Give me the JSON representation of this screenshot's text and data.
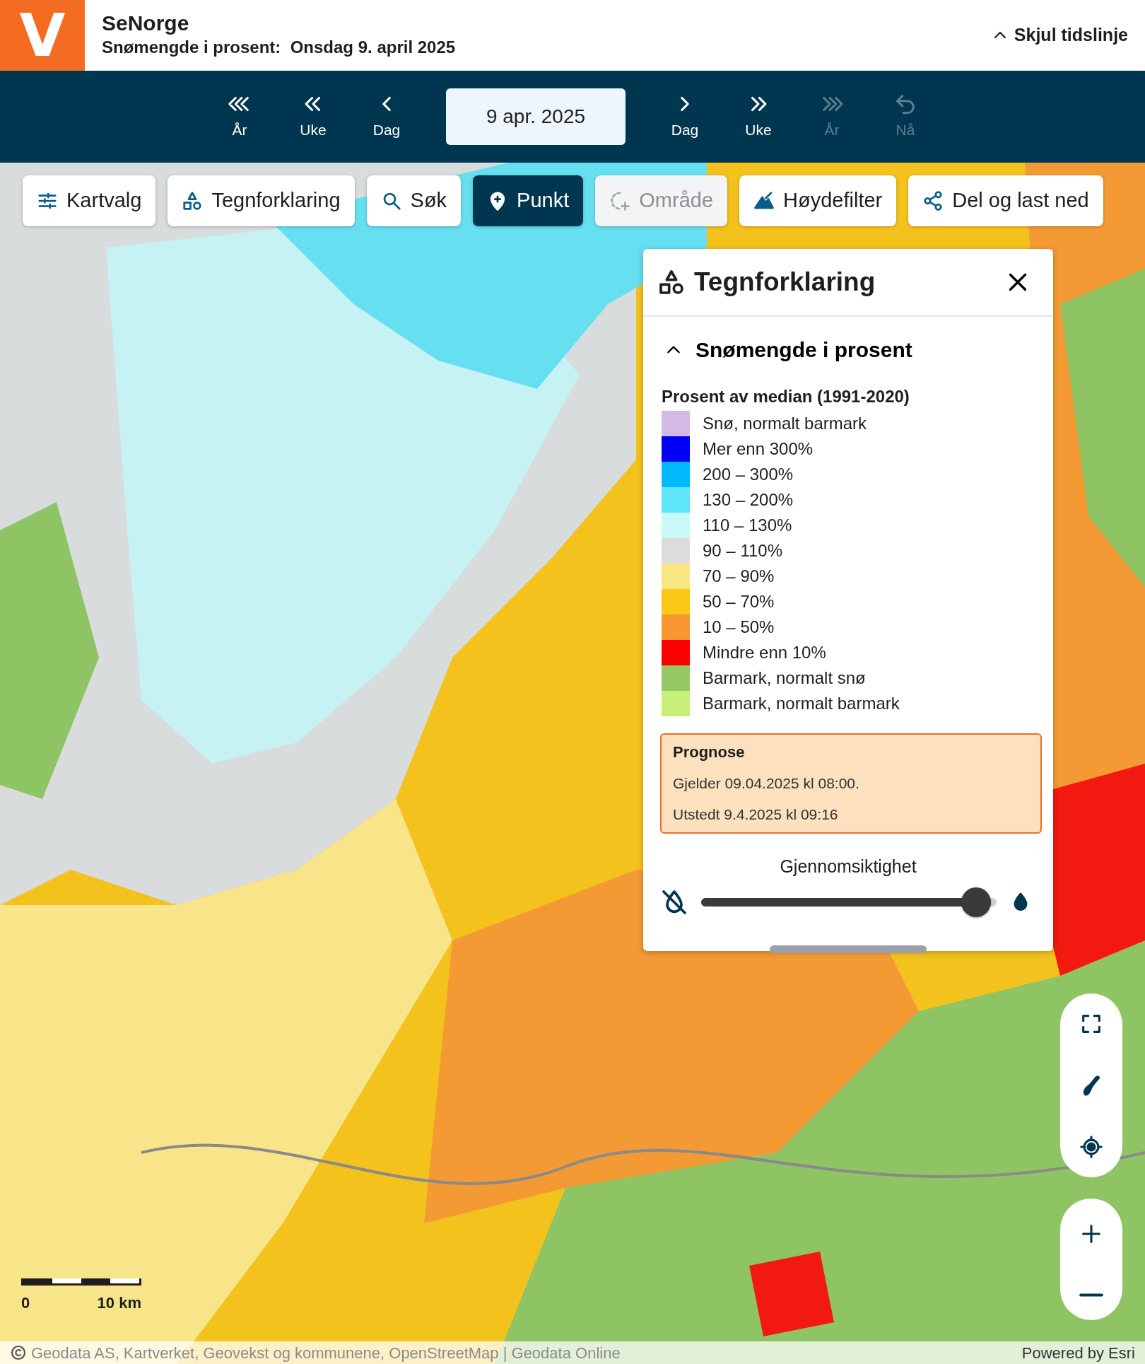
{
  "header": {
    "logo": "V",
    "title": "SeNorge",
    "subtitle": "Snømengde i prosent:  Onsdag 9. april 2025",
    "toggle": "Skjul tidslinje"
  },
  "timeline": {
    "back": [
      {
        "kind": "year-back",
        "label": "År",
        "disabled": false
      },
      {
        "kind": "week-back",
        "label": "Uke",
        "disabled": false
      },
      {
        "kind": "day-back",
        "label": "Dag",
        "disabled": false
      }
    ],
    "date": "9 apr. 2025",
    "forward": [
      {
        "kind": "day-forward",
        "label": "Dag",
        "disabled": false
      },
      {
        "kind": "week-forward",
        "label": "Uke",
        "disabled": false
      },
      {
        "kind": "year-forward",
        "label": "År",
        "disabled": true
      },
      {
        "kind": "now",
        "label": "Nå",
        "disabled": true
      }
    ]
  },
  "toolbar": [
    {
      "kind": "sliders",
      "label": "Kartvalg",
      "selected": false,
      "disabled": false
    },
    {
      "kind": "shapes",
      "label": "Tegnforklaring",
      "selected": false,
      "disabled": false
    },
    {
      "kind": "search",
      "label": "Søk",
      "selected": false,
      "disabled": false
    },
    {
      "kind": "pin",
      "label": "Punkt",
      "selected": true,
      "disabled": false
    },
    {
      "kind": "area",
      "label": "Område",
      "selected": false,
      "disabled": true
    },
    {
      "kind": "mountain",
      "label": "Høydefilter",
      "selected": false,
      "disabled": false
    },
    {
      "kind": "share",
      "label": "Del og last ned",
      "selected": false,
      "disabled": false
    }
  ],
  "legend": {
    "title": "Tegnforklaring",
    "section": {
      "title": "Snømengde i prosent",
      "expanded": true
    },
    "subtitle": "Prosent av median (1991-2020)",
    "entries": [
      {
        "label": "Snø, normalt barmark",
        "color": "#d4b9e6"
      },
      {
        "label": "Mer enn 300%",
        "color": "#0000f5"
      },
      {
        "label": "200 – 300%",
        "color": "#00b9fa"
      },
      {
        "label": "130 – 200%",
        "color": "#5ee6fa"
      },
      {
        "label": "110 – 130%",
        "color": "#c8fafa"
      },
      {
        "label": "90 – 110%",
        "color": "#dcdcdc"
      },
      {
        "label": "70 – 90%",
        "color": "#fae682"
      },
      {
        "label": "50 – 70%",
        "color": "#fac814"
      },
      {
        "label": "10 – 50%",
        "color": "#fa9632"
      },
      {
        "label": "Mindre enn 10%",
        "color": "#fa0000"
      },
      {
        "label": "Barmark, normalt snø",
        "color": "#96c864"
      },
      {
        "label": "Barmark, normalt barmark",
        "color": "#c8f078"
      }
    ],
    "forecast": {
      "title": "Prognose",
      "lines": [
        "Gjelder 09.04.2025 kl 08:00.",
        "Utstedt 9.4.2025 kl 09:16"
      ]
    },
    "opacity": {
      "label": "Gjennomsiktighet",
      "level": 0.98
    }
  },
  "scale": {
    "start": "0",
    "end": "10 km"
  },
  "attribution": {
    "text": "Geodata AS, Kartverket, Geovekst og kommunene, OpenStreetMap | Geodata Online",
    "powered": "Powered by Esri"
  }
}
